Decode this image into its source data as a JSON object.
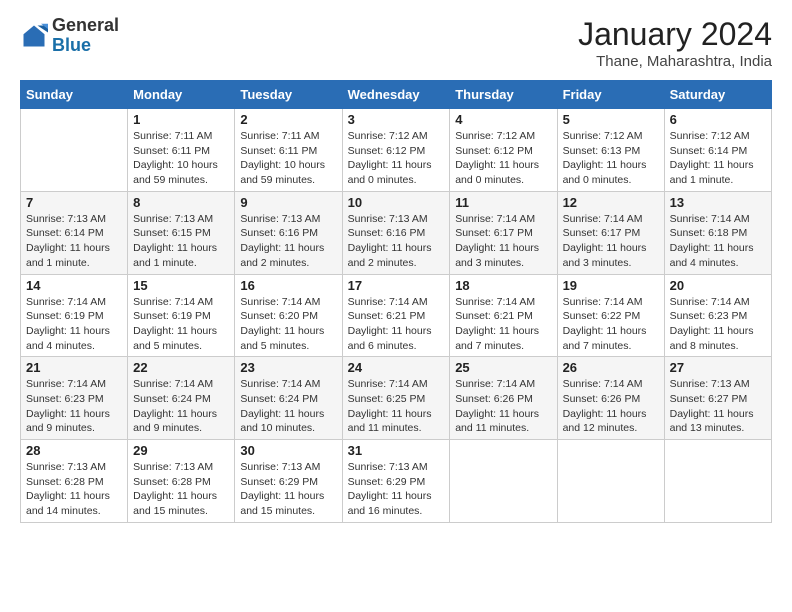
{
  "header": {
    "logo_general": "General",
    "logo_blue": "Blue",
    "month_title": "January 2024",
    "subtitle": "Thane, Maharashtra, India"
  },
  "weekdays": [
    "Sunday",
    "Monday",
    "Tuesday",
    "Wednesday",
    "Thursday",
    "Friday",
    "Saturday"
  ],
  "weeks": [
    [
      {
        "day": "",
        "info": ""
      },
      {
        "day": "1",
        "info": "Sunrise: 7:11 AM\nSunset: 6:11 PM\nDaylight: 10 hours\nand 59 minutes."
      },
      {
        "day": "2",
        "info": "Sunrise: 7:11 AM\nSunset: 6:11 PM\nDaylight: 10 hours\nand 59 minutes."
      },
      {
        "day": "3",
        "info": "Sunrise: 7:12 AM\nSunset: 6:12 PM\nDaylight: 11 hours\nand 0 minutes."
      },
      {
        "day": "4",
        "info": "Sunrise: 7:12 AM\nSunset: 6:12 PM\nDaylight: 11 hours\nand 0 minutes."
      },
      {
        "day": "5",
        "info": "Sunrise: 7:12 AM\nSunset: 6:13 PM\nDaylight: 11 hours\nand 0 minutes."
      },
      {
        "day": "6",
        "info": "Sunrise: 7:12 AM\nSunset: 6:14 PM\nDaylight: 11 hours\nand 1 minute."
      }
    ],
    [
      {
        "day": "7",
        "info": "Sunrise: 7:13 AM\nSunset: 6:14 PM\nDaylight: 11 hours\nand 1 minute."
      },
      {
        "day": "8",
        "info": "Sunrise: 7:13 AM\nSunset: 6:15 PM\nDaylight: 11 hours\nand 1 minute."
      },
      {
        "day": "9",
        "info": "Sunrise: 7:13 AM\nSunset: 6:16 PM\nDaylight: 11 hours\nand 2 minutes."
      },
      {
        "day": "10",
        "info": "Sunrise: 7:13 AM\nSunset: 6:16 PM\nDaylight: 11 hours\nand 2 minutes."
      },
      {
        "day": "11",
        "info": "Sunrise: 7:14 AM\nSunset: 6:17 PM\nDaylight: 11 hours\nand 3 minutes."
      },
      {
        "day": "12",
        "info": "Sunrise: 7:14 AM\nSunset: 6:17 PM\nDaylight: 11 hours\nand 3 minutes."
      },
      {
        "day": "13",
        "info": "Sunrise: 7:14 AM\nSunset: 6:18 PM\nDaylight: 11 hours\nand 4 minutes."
      }
    ],
    [
      {
        "day": "14",
        "info": "Sunrise: 7:14 AM\nSunset: 6:19 PM\nDaylight: 11 hours\nand 4 minutes."
      },
      {
        "day": "15",
        "info": "Sunrise: 7:14 AM\nSunset: 6:19 PM\nDaylight: 11 hours\nand 5 minutes."
      },
      {
        "day": "16",
        "info": "Sunrise: 7:14 AM\nSunset: 6:20 PM\nDaylight: 11 hours\nand 5 minutes."
      },
      {
        "day": "17",
        "info": "Sunrise: 7:14 AM\nSunset: 6:21 PM\nDaylight: 11 hours\nand 6 minutes."
      },
      {
        "day": "18",
        "info": "Sunrise: 7:14 AM\nSunset: 6:21 PM\nDaylight: 11 hours\nand 7 minutes."
      },
      {
        "day": "19",
        "info": "Sunrise: 7:14 AM\nSunset: 6:22 PM\nDaylight: 11 hours\nand 7 minutes."
      },
      {
        "day": "20",
        "info": "Sunrise: 7:14 AM\nSunset: 6:23 PM\nDaylight: 11 hours\nand 8 minutes."
      }
    ],
    [
      {
        "day": "21",
        "info": "Sunrise: 7:14 AM\nSunset: 6:23 PM\nDaylight: 11 hours\nand 9 minutes."
      },
      {
        "day": "22",
        "info": "Sunrise: 7:14 AM\nSunset: 6:24 PM\nDaylight: 11 hours\nand 9 minutes."
      },
      {
        "day": "23",
        "info": "Sunrise: 7:14 AM\nSunset: 6:24 PM\nDaylight: 11 hours\nand 10 minutes."
      },
      {
        "day": "24",
        "info": "Sunrise: 7:14 AM\nSunset: 6:25 PM\nDaylight: 11 hours\nand 11 minutes."
      },
      {
        "day": "25",
        "info": "Sunrise: 7:14 AM\nSunset: 6:26 PM\nDaylight: 11 hours\nand 11 minutes."
      },
      {
        "day": "26",
        "info": "Sunrise: 7:14 AM\nSunset: 6:26 PM\nDaylight: 11 hours\nand 12 minutes."
      },
      {
        "day": "27",
        "info": "Sunrise: 7:13 AM\nSunset: 6:27 PM\nDaylight: 11 hours\nand 13 minutes."
      }
    ],
    [
      {
        "day": "28",
        "info": "Sunrise: 7:13 AM\nSunset: 6:28 PM\nDaylight: 11 hours\nand 14 minutes."
      },
      {
        "day": "29",
        "info": "Sunrise: 7:13 AM\nSunset: 6:28 PM\nDaylight: 11 hours\nand 15 minutes."
      },
      {
        "day": "30",
        "info": "Sunrise: 7:13 AM\nSunset: 6:29 PM\nDaylight: 11 hours\nand 15 minutes."
      },
      {
        "day": "31",
        "info": "Sunrise: 7:13 AM\nSunset: 6:29 PM\nDaylight: 11 hours\nand 16 minutes."
      },
      {
        "day": "",
        "info": ""
      },
      {
        "day": "",
        "info": ""
      },
      {
        "day": "",
        "info": ""
      }
    ]
  ]
}
